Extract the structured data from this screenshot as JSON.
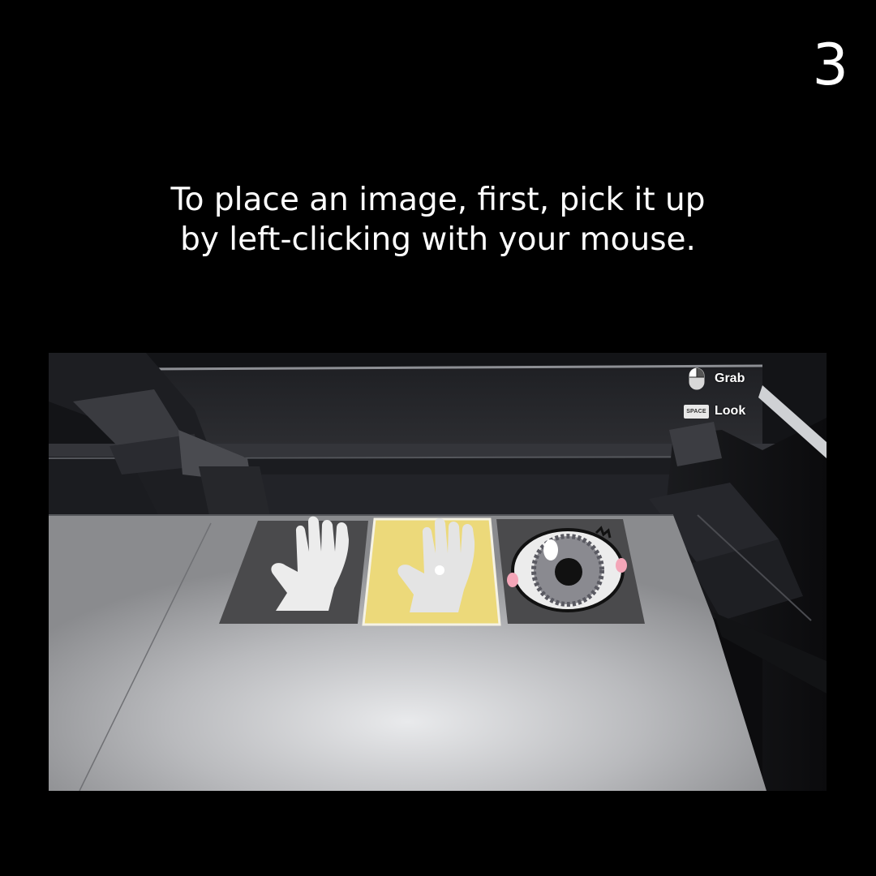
{
  "step": {
    "number": "3"
  },
  "instruction": {
    "line1": "To place an image, first, pick it up",
    "line2": "by left-clicking with your mouse."
  },
  "hud": {
    "grab_label": "Grab",
    "grab_icon": "mouse-left-click-icon",
    "look_label": "Look",
    "look_key": "SPACE"
  },
  "cards": [
    {
      "name": "hand",
      "background": "#4a4a4c"
    },
    {
      "name": "hand-with-mark",
      "background": "#ecd97a",
      "highlighted": true
    },
    {
      "name": "eye",
      "background": "#4a4a4c"
    }
  ]
}
